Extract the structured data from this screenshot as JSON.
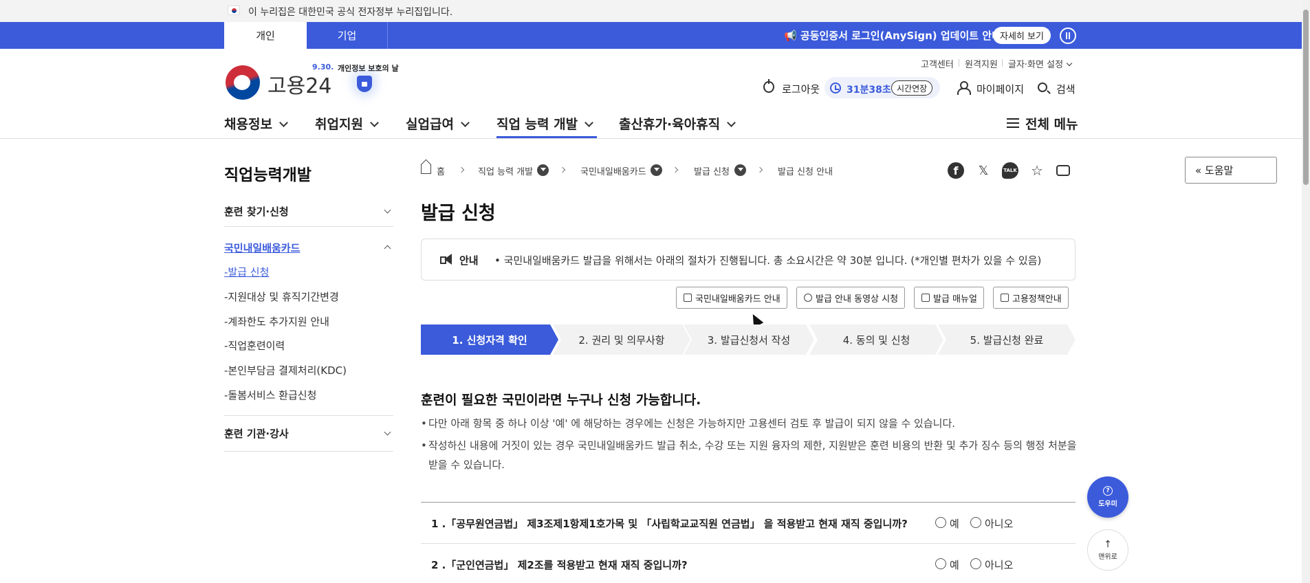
{
  "gov_banner": {
    "text": "이 누리집은 대한민국 공식 전자정부 누리집입니다."
  },
  "top_tabs": [
    {
      "label": "개인"
    },
    {
      "label": "기업"
    }
  ],
  "notice": {
    "text": "📢 공동인증서 로그인(AnySign) 업데이트 안내",
    "button": "자세히 보기"
  },
  "logo": {
    "text": "고용24",
    "event_date": "9.30.",
    "event_label": "개인정보 보호의 날"
  },
  "util_links": [
    "고객센터",
    "원격지원",
    "글자·화면 설정"
  ],
  "session": {
    "logout": "로그아웃",
    "timer": "31분38초",
    "extend": "시간연장",
    "mypage": "마이페이지",
    "search": "검색"
  },
  "gnb": [
    "채용정보",
    "취업지원",
    "실업급여",
    "직업 능력 개발",
    "출산휴가·육아휴직"
  ],
  "all_menu": "전체 메뉴",
  "sidebar": {
    "title": "직업능력개발",
    "groups": [
      "훈련 찾기·신청",
      "국민내일배움카드",
      "훈련 기관·강사"
    ],
    "sub_items": [
      "-발급 신청",
      "-지원대상 및 휴직기간변경",
      "-계좌한도 추가지원 안내",
      "-직업훈련이력",
      "-본인부담금 결제처리(KDC)",
      "-돌봄서비스 환급신청"
    ]
  },
  "breadcrumb": [
    "홈",
    "직업 능력 개발",
    "국민내일배움카드",
    "발급 신청",
    "발급 신청 안내"
  ],
  "share": {
    "facebook": "f",
    "x": "𝕏",
    "talk": "TALK",
    "star": "☆"
  },
  "help_button": "« 도움말",
  "page_title": "발급 신청",
  "guide": {
    "label": "안내",
    "text": "• 국민내일배움카드 발급을 위해서는 아래의 절차가 진행됩니다. 총 소요시간은 약 30분 입니다. (*개인별 편차가 있을 수 있음)"
  },
  "link_buttons": [
    "국민내일배움카드 안내",
    "발급 안내 동영상 시청",
    "발급 매뉴얼",
    "고용정책안내"
  ],
  "steps": [
    "1. 신청자격 확인",
    "2. 권리 및 의무사항",
    "3. 발급신청서 작성",
    "4. 동의 및 신청",
    "5. 발급신청 완료"
  ],
  "section": {
    "title": "훈련이 필요한 국민이라면 누구나 신청 가능합니다.",
    "bullets": [
      "다만 아래 항목 중 하나 이상 '예' 에 해당하는 경우에는 신청은 가능하지만 고용센터 검토 후 발급이 되지 않을 수 있습니다.",
      "작성하신 내용에 거짓이 있는 경우 국민내일배움카드 발급 취소, 수강 또는 지원 융자의 제한, 지원받은 훈련 비용의 반환 및 추가 징수 등의 행정 처분을 받을 수 있습니다."
    ]
  },
  "questions": [
    {
      "text": "1 .「공무원연금법」 제3조제1항제1호가목 및 「사립학교교직원 연금법」 을 적용받고 현재 재직 중입니까?",
      "yes": "예",
      "no": "아니오"
    },
    {
      "text": "2 .「군인연금법」 제2조를 적용받고 현재 재직 중입니까?",
      "yes": "예",
      "no": "아니오"
    }
  ],
  "fab": {
    "help": "도우미",
    "help_icon": "?",
    "top": "맨위로",
    "top_icon": "↑"
  },
  "colors": {
    "primary": "#3b5bdb"
  }
}
